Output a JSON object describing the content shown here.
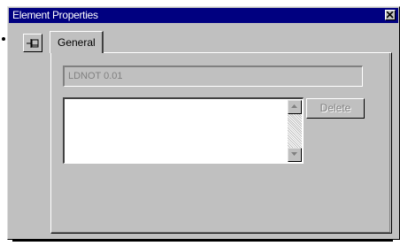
{
  "window": {
    "title": "Element Properties",
    "close_icon": "close-icon"
  },
  "toolbar": {
    "pin_icon": "pushpin-icon"
  },
  "tabs": [
    {
      "label": "General",
      "selected": true
    }
  ],
  "general": {
    "name_value": "LDNOT 0.01",
    "list_items": [],
    "delete_label": "Delete"
  },
  "colors": {
    "titlebar": "#000080",
    "face": "#c0c0c0",
    "disabled_text": "#808080"
  }
}
